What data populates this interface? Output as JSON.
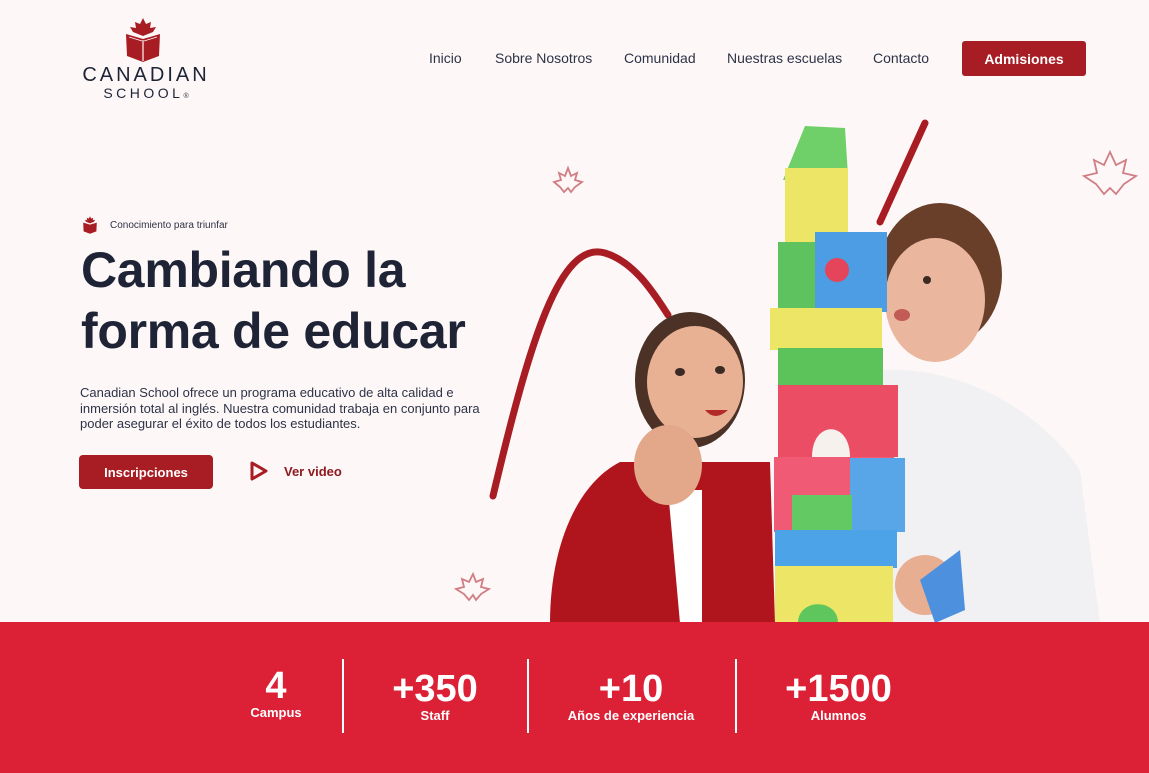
{
  "brand": {
    "name_line1": "CANADIAN",
    "name_line2": "SCHOOL",
    "registered_mark": "®",
    "logo_icon": "maple-book-icon",
    "color_primary": "#a81d24",
    "color_band": "#dc2137"
  },
  "nav": {
    "items": [
      {
        "label": "Inicio"
      },
      {
        "label": "Sobre Nosotros"
      },
      {
        "label": "Comunidad"
      },
      {
        "label": "Nuestras escuelas"
      },
      {
        "label": "Contacto"
      }
    ],
    "cta_label": "Admisiones"
  },
  "hero": {
    "tagline": "Conocimiento para triunfar",
    "headline_line1": "Cambiando la",
    "headline_line2": "forma de educar",
    "description": "Canadian School ofrece un programa educativo de alta calidad e inmersión total al inglés. Nuestra comunidad trabaja en conjunto para poder asegurar el éxito de todos los estudiantes.",
    "primary_button": "Inscripciones",
    "video_link": "Ver video",
    "video_icon": "play-icon"
  },
  "stats": [
    {
      "value": "4",
      "label": "Campus"
    },
    {
      "value": "+350",
      "label": "Staff"
    },
    {
      "value": "+10",
      "label": "Años de experiencia"
    },
    {
      "value": "+1500",
      "label": "Alumnos"
    }
  ]
}
